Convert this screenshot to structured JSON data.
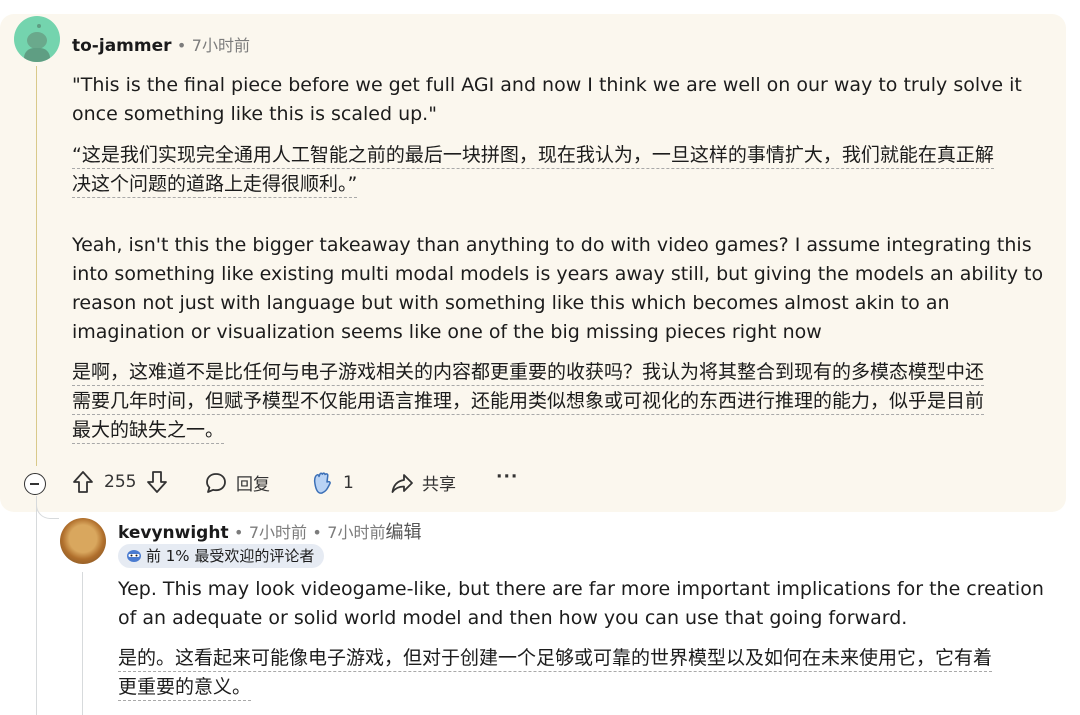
{
  "comment1": {
    "username": "to-jammer",
    "separator": "•",
    "time": "7小时前",
    "quote_en": "\"This is the final piece before we get full AGI and now I think we are well on our way to truly solve it once something like this is scaled up.\"",
    "quote_zh_line1": "“这是我们实现完全通用人工智能之前的最后一块拼图，现在我认为，一旦这样的事情扩大，我们就能在真正解",
    "quote_zh_line2": "决这个问题的道路上走得很顺利。”",
    "body_en": "Yeah, isn't this the bigger takeaway than anything to do with video games? I assume integrating this into something like existing multi modal models is years away still, but giving the models an ability to reason not just with language but with something like this which becomes almost akin to an imagination or visualization seems like one of the big missing pieces right now",
    "body_zh_line1": "是啊，这难道不是比任何与电子游戏相关的内容都更重要的收获吗？我认为将其整合到现有的多模态模型中还",
    "body_zh_line2": "需要几年时间，但赋予模型不仅能用语言推理，还能用类似想象或可视化的东西进行推理的能力，似乎是目前",
    "body_zh_line3": "最大的缺失之一。",
    "actions": {
      "upvotes": "255",
      "reply_label": "回复",
      "award_count": "1",
      "share_label": "共享",
      "more_label": "···"
    }
  },
  "comment2": {
    "username": "kevynwight",
    "separator": "•",
    "time": "7小时前",
    "edited_time": "7小时前",
    "edited_label": "编辑",
    "flair": "前 1% 最受欢迎的评论者",
    "body_en": "Yep. This may look videogame-like, but there are far more important implications for the creation of an adequate or solid world model and then how you can use that going forward.",
    "body_zh_line1": "是的。这看起来可能像电子游戏，但对于创建一个足够或可靠的世界模型以及如何在未来使用它，它有着",
    "body_zh_line2": "更重要的意义。"
  },
  "colors": {
    "card_bg": "#fbf7ee",
    "thread_line": "#d9c98a",
    "flair_bg": "#e6ebf3"
  }
}
